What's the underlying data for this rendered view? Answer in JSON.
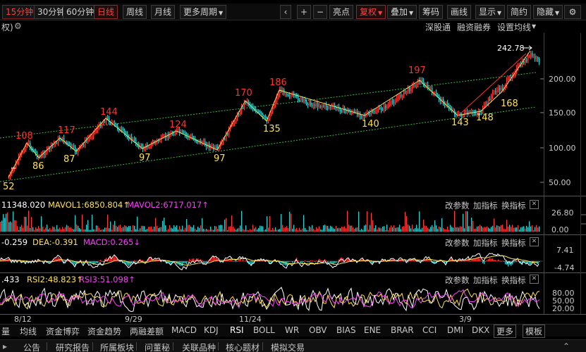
{
  "toolbar": {
    "period_15m": "15分钟",
    "period_30m": "30分钟",
    "period_60m": "60分钟",
    "daily": "日线",
    "weekly": "周线",
    "monthly": "月线",
    "more_periods": "更多周期",
    "minus": "−",
    "spot": "亮点",
    "adjust": "复权",
    "overlay": "叠加",
    "chips": "筹码",
    "draw": "画线",
    "display": "显示",
    "brief": "简约",
    "hide": "隐藏"
  },
  "subbar": {
    "left_label": "权)",
    "shenzhen_connect": "深股通",
    "margin_trading": "融资融券",
    "ma_settings": "设置均线"
  },
  "price_chart": {
    "top_label": "242.78",
    "y_ticks": [
      "200.00",
      "150.00",
      "100.00",
      "50.00"
    ],
    "annotations": {
      "highs": [
        "108",
        "117",
        "144",
        "124",
        "170",
        "186",
        "197"
      ],
      "lows": [
        "52",
        "86",
        "87",
        "97",
        "97",
        "135",
        "140",
        "143",
        "148",
        "168"
      ]
    }
  },
  "volume": {
    "value_label": "11348.020",
    "mavol1": "MAVOL1:6850.804",
    "mavol2": "MAVOL2:6717.017",
    "y_ticks": [
      "26.80",
      "0.00"
    ]
  },
  "macd": {
    "value_label": "-0.259",
    "dea": "DEA:-0.391",
    "macd": "MACD:0.265",
    "y_ticks": [
      "7.41",
      "-4.74"
    ]
  },
  "rsi": {
    "value_label": ".433",
    "rsi2": "RSI2:48.823",
    "rsi3": "RSI3:51.098",
    "y_ticks": [
      "80.00",
      "50.00",
      "20.00"
    ]
  },
  "panel_controls": {
    "change_params": "改参数",
    "add_indicator": "加指标",
    "switch_indicator": "换指标"
  },
  "x_axis": {
    "dates": [
      "8/12",
      "9/29",
      "11/24",
      "3/9"
    ]
  },
  "indicator_tabs": [
    "量",
    "均线",
    "资金博弈",
    "资金趋势",
    "两融差额",
    "MACD",
    "KDJ",
    "RSI",
    "BOLL",
    "WR",
    "OBV",
    "BIAS",
    "ENE",
    "BRAR",
    "CCI",
    "DMI",
    "DKX",
    "更多",
    "模板"
  ],
  "active_indicator_tab": "RSI",
  "status_items": [
    "公告",
    "研究报告",
    "所属板块",
    "问董秘",
    "关联品种",
    "核心题材",
    "模拟交易"
  ],
  "colors": {
    "up": "#ff3b3b",
    "down": "#22d3d3",
    "yellow": "#ffe14d",
    "magenta": "#ff3cff",
    "white": "#ffffff",
    "channel": "#36c236"
  },
  "icons": {
    "settings": "gear-icon",
    "close": "close-icon",
    "dropdown": "chevron-down-icon"
  }
}
